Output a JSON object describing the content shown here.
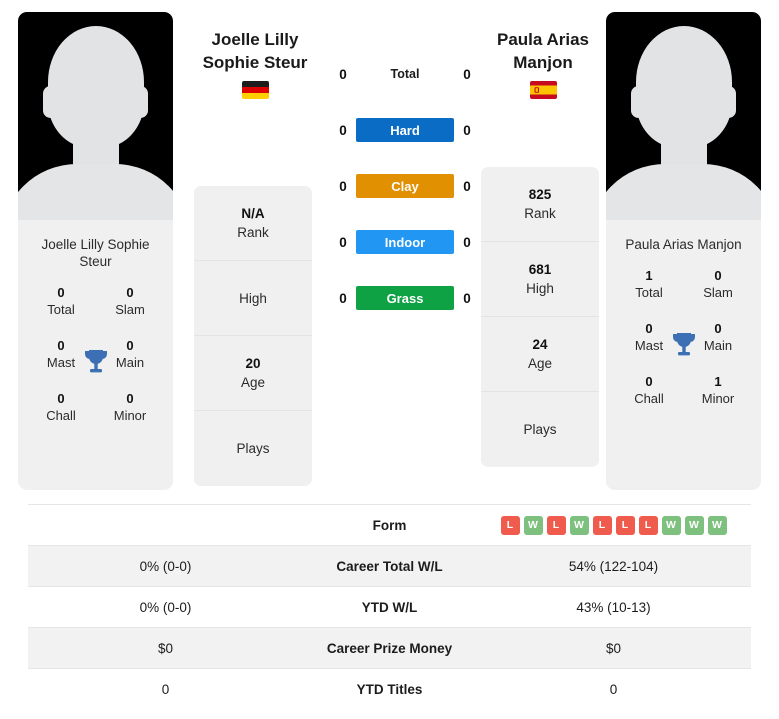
{
  "players": {
    "left": {
      "display_name_line1": "Joelle Lilly",
      "display_name_line2": "Sophie Steur",
      "card_name": "Joelle Lilly Sophie Steur",
      "flag": "de",
      "flag_name": "germany-flag",
      "titles": [
        {
          "value": "0",
          "label": "Total"
        },
        {
          "value": "0",
          "label": "Slam"
        },
        {
          "value": "0",
          "label": "Mast"
        },
        {
          "value": "0",
          "label": "Main"
        },
        {
          "value": "0",
          "label": "Chall"
        },
        {
          "value": "0",
          "label": "Minor"
        }
      ],
      "info": [
        {
          "value": "N/A",
          "label": "Rank"
        },
        {
          "value": "",
          "label": "High"
        },
        {
          "value": "20",
          "label": "Age"
        },
        {
          "value": "",
          "label": "Plays"
        }
      ]
    },
    "right": {
      "display_name_line1": "Paula Arias",
      "display_name_line2": "Manjon",
      "card_name": "Paula Arias Manjon",
      "flag": "es",
      "flag_name": "spain-flag",
      "titles": [
        {
          "value": "1",
          "label": "Total"
        },
        {
          "value": "0",
          "label": "Slam"
        },
        {
          "value": "0",
          "label": "Mast"
        },
        {
          "value": "0",
          "label": "Main"
        },
        {
          "value": "0",
          "label": "Chall"
        },
        {
          "value": "1",
          "label": "Minor"
        }
      ],
      "info": [
        {
          "value": "825",
          "label": "Rank"
        },
        {
          "value": "681",
          "label": "High"
        },
        {
          "value": "24",
          "label": "Age"
        },
        {
          "value": "",
          "label": "Plays"
        }
      ]
    }
  },
  "h2h_surfaces": [
    {
      "label": "Total",
      "left": "0",
      "right": "0",
      "color": "",
      "text_color": "#1c1c1c",
      "plain": true
    },
    {
      "label": "Hard",
      "left": "0",
      "right": "0",
      "color": "#0a6cc4",
      "text_color": "#ffffff",
      "plain": false
    },
    {
      "label": "Clay",
      "left": "0",
      "right": "0",
      "color": "#e09000",
      "text_color": "#ffffff",
      "plain": false
    },
    {
      "label": "Indoor",
      "left": "0",
      "right": "0",
      "color": "#2196f3",
      "text_color": "#ffffff",
      "plain": false
    },
    {
      "label": "Grass",
      "left": "0",
      "right": "0",
      "color": "#0ea245",
      "text_color": "#ffffff",
      "plain": false
    }
  ],
  "form": {
    "label": "Form",
    "left_results": [],
    "right_results": [
      "L",
      "W",
      "L",
      "W",
      "L",
      "L",
      "L",
      "W",
      "W",
      "W"
    ],
    "win_color": "#7ec07e",
    "loss_color": "#ef5b4c"
  },
  "stats_rows": [
    {
      "label": "Career Total W/L",
      "left": "0% (0-0)",
      "right": "54% (122-104)"
    },
    {
      "label": "YTD W/L",
      "left": "0% (0-0)",
      "right": "43% (10-13)"
    },
    {
      "label": "Career Prize Money",
      "left": "$0",
      "right": "$0"
    },
    {
      "label": "YTD Titles",
      "left": "0",
      "right": "0"
    }
  ],
  "colors": {
    "trophy": "#3d6fb4",
    "card_bg": "#f0f0f0",
    "row_shade": "#f2f2f2"
  }
}
